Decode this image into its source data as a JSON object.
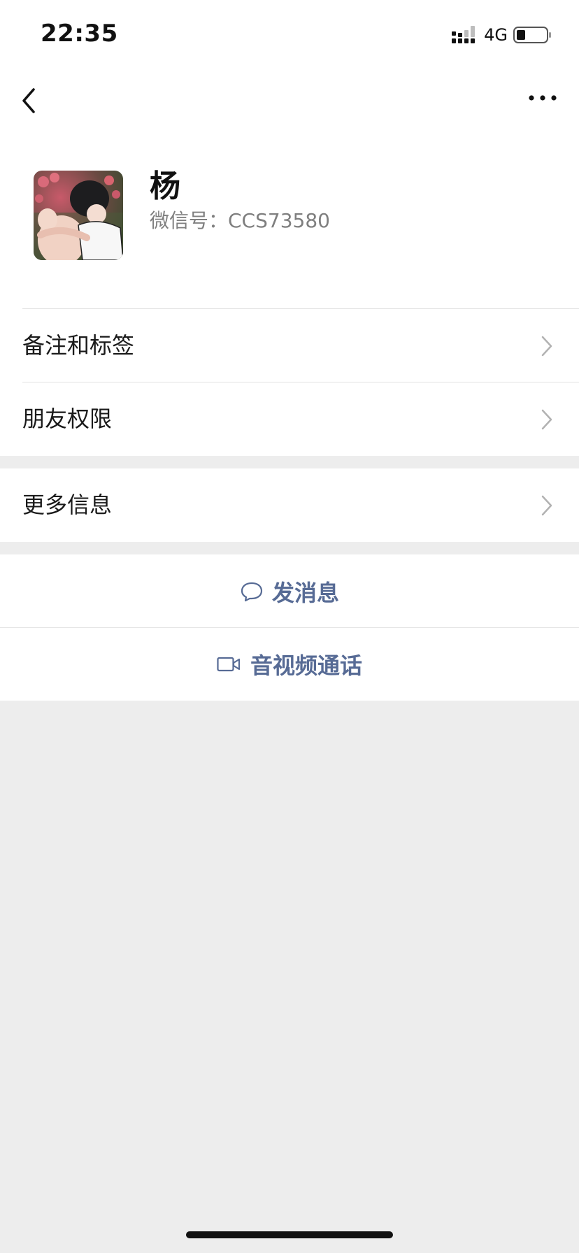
{
  "status_bar": {
    "time": "22:35",
    "network": "4G",
    "icons": [
      "signal-icon",
      "battery-icon"
    ]
  },
  "nav": {
    "back_icon": "chevron-left-icon",
    "more_icon": "more-dots-icon"
  },
  "profile": {
    "name": "杨",
    "wechat_id": "微信号：CCS73580"
  },
  "menu_items": [
    {
      "label": "备注和标签"
    },
    {
      "label": "朋友权限"
    },
    {
      "label": "更多信息"
    }
  ],
  "actions": {
    "send_message": "发消息",
    "av_call": "音视频通话",
    "icons": [
      "chat-bubble-icon",
      "video-camera-icon"
    ]
  },
  "colors": {
    "link_blue": "#576b95",
    "background_gray": "#ededed"
  }
}
